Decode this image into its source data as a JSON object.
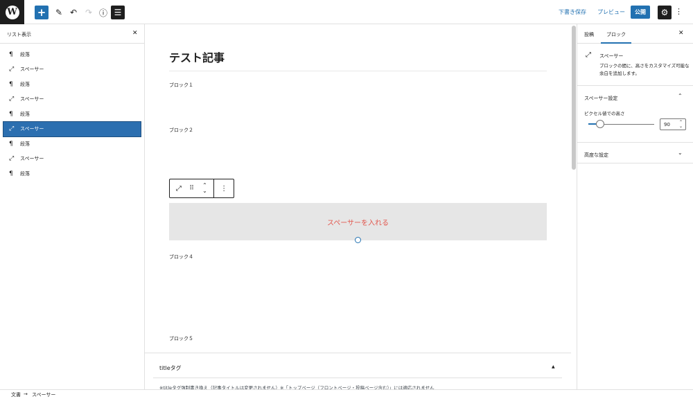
{
  "topbar": {
    "logo_letter": "W",
    "add_icon": "plus-icon",
    "draft_label": "下書き保存",
    "preview_label": "プレビュー",
    "publish_label": "公開"
  },
  "listview": {
    "title": "リスト表示",
    "items": [
      {
        "icon": "paragraph-icon",
        "label": "段落",
        "selected": false
      },
      {
        "icon": "spacer-icon",
        "label": "スペーサー",
        "selected": false
      },
      {
        "icon": "paragraph-icon",
        "label": "段落",
        "selected": false
      },
      {
        "icon": "spacer-icon",
        "label": "スペーサー",
        "selected": false
      },
      {
        "icon": "paragraph-icon",
        "label": "段落",
        "selected": false
      },
      {
        "icon": "spacer-icon",
        "label": "スペーサー",
        "selected": true
      },
      {
        "icon": "paragraph-icon",
        "label": "段落",
        "selected": false
      },
      {
        "icon": "spacer-icon",
        "label": "スペーサー",
        "selected": false
      },
      {
        "icon": "paragraph-icon",
        "label": "段落",
        "selected": false
      }
    ]
  },
  "editor": {
    "post_title": "テスト記事",
    "blocks": [
      "ブロック１",
      "ブロック２",
      "ブロック４",
      "ブロック５"
    ],
    "spacer_label": "スペーサーを入れる"
  },
  "metabox": {
    "title": "titleタグ",
    "note": "※titleタグ強制書き換え（記事タイトルは変更されません）※「トップページ（フロントページ・投稿ページ含む）」には適応されません"
  },
  "sidebar": {
    "tab_post": "投稿",
    "tab_block": "ブロック",
    "block_name": "スペーサー",
    "block_desc": "ブロックの間に、高さをカスタマイズ可能な余白を追加します。",
    "panel_spacer_title": "スペーサー設定",
    "height_label": "ピクセル値での高さ",
    "height_value": "90",
    "height_fraction": 0.18,
    "panel_advanced_title": "高度な設定"
  },
  "breadcrumb": {
    "root": "文書",
    "current": "スペーサー"
  },
  "colors": {
    "accent": "#2271b1",
    "selected_row": "#2c6fb0",
    "spacer_text": "#e2584f"
  }
}
